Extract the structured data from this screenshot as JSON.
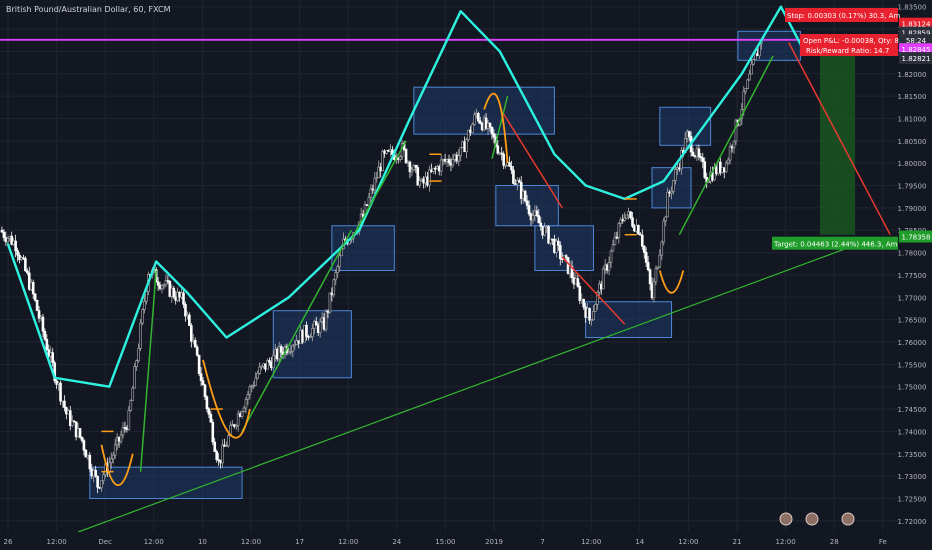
{
  "title": "British Pound/Australian Dollar, 60, FXCM",
  "colors": {
    "background": "#131722",
    "grid": "#1f2430",
    "axis_text": "#b2b5be",
    "candle_up": "#b0b0b0",
    "candle_down": "#ffffff",
    "annotation_cyan": "#2ef2e0",
    "annotation_orange": "#ff9e16",
    "annotation_green": "#31b52e",
    "annotation_red": "#e83a2f",
    "zone_fill": "#1e3a66",
    "zone_stroke": "#4c88d8",
    "magenta": "#e040fb",
    "stop_red": "#e8212e",
    "target_green": "#1f9c29"
  },
  "chart_data": {
    "type": "candlestick",
    "title": "British Pound/Australian Dollar, 60, FXCM",
    "ylim": [
      1.7175,
      1.8365
    ],
    "y_ticks": [
      "1.72000",
      "1.72500",
      "1.73000",
      "1.73500",
      "1.74000",
      "1.74500",
      "1.75000",
      "1.75500",
      "1.76000",
      "1.76500",
      "1.77000",
      "1.77500",
      "1.78000",
      "1.78500",
      "1.79000",
      "1.79500",
      "1.80000",
      "1.80500",
      "1.81000",
      "1.81500",
      "1.82000",
      "1.82500",
      "1.83000",
      "1.83500"
    ],
    "x_ticks": [
      "26",
      "12:00",
      "Dec",
      "12:00",
      "10",
      "12:00",
      "17",
      "12:00",
      "24",
      "15:00",
      "2019",
      "7",
      "12:00",
      "14",
      "12:00",
      "21",
      "12:00",
      "28",
      "Fe"
    ],
    "price_path": [
      {
        "x": 0,
        "y": 1.785
      },
      {
        "x": 4,
        "y": 1.782
      },
      {
        "x": 8,
        "y": 1.772
      },
      {
        "x": 13,
        "y": 1.756
      },
      {
        "x": 17,
        "y": 1.744
      },
      {
        "x": 21,
        "y": 1.738
      },
      {
        "x": 25,
        "y": 1.728
      },
      {
        "x": 28,
        "y": 1.733
      },
      {
        "x": 33,
        "y": 1.743
      },
      {
        "x": 38,
        "y": 1.776
      },
      {
        "x": 43,
        "y": 1.772
      },
      {
        "x": 47,
        "y": 1.769
      },
      {
        "x": 52,
        "y": 1.75
      },
      {
        "x": 56,
        "y": 1.733
      },
      {
        "x": 60,
        "y": 1.742
      },
      {
        "x": 66,
        "y": 1.753
      },
      {
        "x": 72,
        "y": 1.758
      },
      {
        "x": 78,
        "y": 1.762
      },
      {
        "x": 83,
        "y": 1.764
      },
      {
        "x": 88,
        "y": 1.782
      },
      {
        "x": 93,
        "y": 1.788
      },
      {
        "x": 98,
        "y": 1.801
      },
      {
        "x": 103,
        "y": 1.803
      },
      {
        "x": 108,
        "y": 1.795
      },
      {
        "x": 113,
        "y": 1.8
      },
      {
        "x": 118,
        "y": 1.802
      },
      {
        "x": 122,
        "y": 1.811
      },
      {
        "x": 126,
        "y": 1.806
      },
      {
        "x": 131,
        "y": 1.798
      },
      {
        "x": 136,
        "y": 1.789
      },
      {
        "x": 141,
        "y": 1.783
      },
      {
        "x": 146,
        "y": 1.776
      },
      {
        "x": 151,
        "y": 1.765
      },
      {
        "x": 155,
        "y": 1.776
      },
      {
        "x": 160,
        "y": 1.789
      },
      {
        "x": 164,
        "y": 1.785
      },
      {
        "x": 167,
        "y": 1.77
      },
      {
        "x": 171,
        "y": 1.792
      },
      {
        "x": 176,
        "y": 1.806
      },
      {
        "x": 181,
        "y": 1.797
      },
      {
        "x": 186,
        "y": 1.8
      },
      {
        "x": 191,
        "y": 1.816
      },
      {
        "x": 195,
        "y": 1.828
      }
    ],
    "horizontal_line": 1.8276,
    "trendline": [
      {
        "x": 20,
        "y": 1.7175
      },
      {
        "x": 217,
        "y": 1.781
      }
    ],
    "zones": [
      {
        "x0": 23,
        "x1": 62,
        "y0": 1.725,
        "y1": 1.732
      },
      {
        "x0": 70,
        "x1": 90,
        "y0": 1.752,
        "y1": 1.767
      },
      {
        "x0": 85,
        "x1": 101,
        "y0": 1.776,
        "y1": 1.786
      },
      {
        "x0": 106,
        "x1": 142,
        "y0": 1.8065,
        "y1": 1.817
      },
      {
        "x0": 127,
        "x1": 143,
        "y0": 1.786,
        "y1": 1.795
      },
      {
        "x0": 137,
        "x1": 152,
        "y0": 1.776,
        "y1": 1.786
      },
      {
        "x0": 150,
        "x1": 172,
        "y0": 1.761,
        "y1": 1.769
      },
      {
        "x0": 167,
        "x1": 177,
        "y0": 1.79,
        "y1": 1.799
      },
      {
        "x0": 169,
        "x1": 182,
        "y0": 1.804,
        "y1": 1.8125
      },
      {
        "x0": 189,
        "x1": 205,
        "y0": 1.823,
        "y1": 1.8295
      }
    ],
    "target_box": {
      "x0": 210,
      "x1": 219,
      "y0": 1.784,
      "y1": 1.8285
    }
  },
  "labels": {
    "stop": "Stop: 0.00303 (0.17%) 30.3, Am",
    "open_pnl": "Open P&L: -0.00038, Qty: 8",
    "risk_reward": "Risk/Reward Ratio: 14.7",
    "target": "Target: 0.04463 (2.44%) 446.3, Am",
    "price_stop": "1.83124",
    "price_current": "1.82859",
    "price_timer": "58:24",
    "price_magenta": "1.82845",
    "price_last": "1.82821",
    "price_target": "1.78358"
  }
}
